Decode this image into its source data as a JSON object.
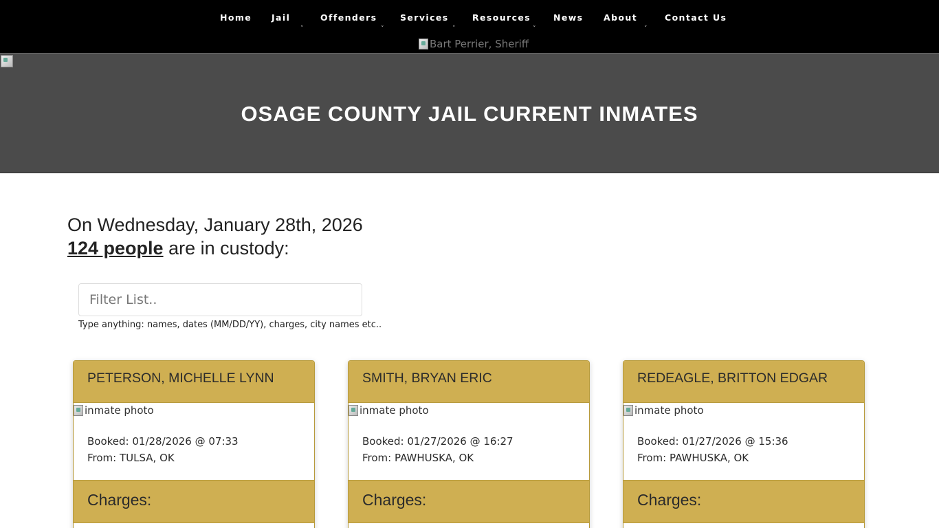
{
  "nav": {
    "items": [
      {
        "label": "Home",
        "has_dropdown": false
      },
      {
        "label": "Jail",
        "has_dropdown": true
      },
      {
        "label": "Offenders",
        "has_dropdown": true
      },
      {
        "label": "Services",
        "has_dropdown": true
      },
      {
        "label": "Resources",
        "has_dropdown": true
      },
      {
        "label": "News",
        "has_dropdown": false
      },
      {
        "label": "About",
        "has_dropdown": true
      },
      {
        "label": "Contact Us",
        "has_dropdown": false
      }
    ],
    "caret": "˅",
    "sheriff_alt": "Bart Perrier, Sheriff"
  },
  "hero": {
    "title": "OSAGE COUNTY JAIL CURRENT INMATES"
  },
  "summary": {
    "date_line": "On Wednesday, January 28th, 2026",
    "count_link": "124 people",
    "count_suffix": " are in custody:"
  },
  "filter": {
    "placeholder": "Filter List..",
    "value": "",
    "help": "Type anything: names, dates (MM/DD/YY), charges, city names etc.."
  },
  "inmates": [
    {
      "name": "PETERSON, MICHELLE LYNN",
      "photo_alt": "inmate photo",
      "booked": "Booked: 01/28/2026 @ 07:33",
      "from": "From: TULSA, OK",
      "charges_label": "Charges:"
    },
    {
      "name": "SMITH, BRYAN ERIC",
      "photo_alt": "inmate photo",
      "booked": "Booked: 01/27/2026 @ 16:27",
      "from": "From: PAWHUSKA, OK",
      "charges_label": "Charges:"
    },
    {
      "name": "REDEAGLE, BRITTON EDGAR",
      "photo_alt": "inmate photo",
      "booked": "Booked: 01/27/2026 @ 15:36",
      "from": "From: PAWHUSKA, OK",
      "charges_label": "Charges:"
    }
  ],
  "colors": {
    "nav_bg": "#000000",
    "hero_bg": "#4b4b4b",
    "card_accent": "#cfaf52"
  }
}
